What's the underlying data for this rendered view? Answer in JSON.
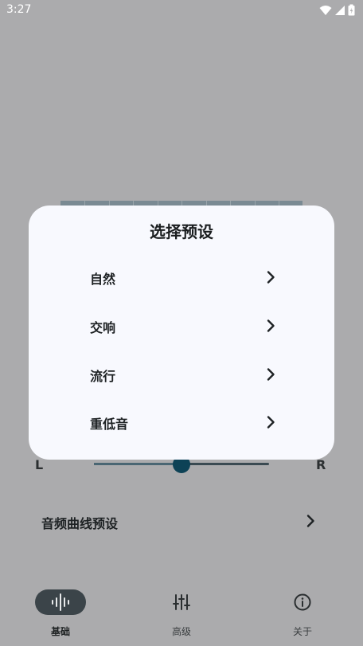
{
  "status_bar": {
    "time": "3:27"
  },
  "balance": {
    "left_label": "L",
    "right_label": "R"
  },
  "preset": {
    "label": "音频曲线预设"
  },
  "dialog": {
    "title": "选择预设",
    "options": [
      {
        "label": "自然"
      },
      {
        "label": "交响"
      },
      {
        "label": "流行"
      },
      {
        "label": "重低音"
      }
    ]
  },
  "bottom_nav": {
    "items": [
      {
        "label": "基础",
        "icon": "waveform-icon",
        "active": true
      },
      {
        "label": "高级",
        "icon": "sliders-icon",
        "active": false
      },
      {
        "label": "关于",
        "icon": "info-icon",
        "active": false
      }
    ]
  },
  "colors": {
    "scrim": "#ababad",
    "dialog_bg": "#f8f9fe",
    "accent": "#0d4256",
    "nav_pill": "#3b4449"
  }
}
